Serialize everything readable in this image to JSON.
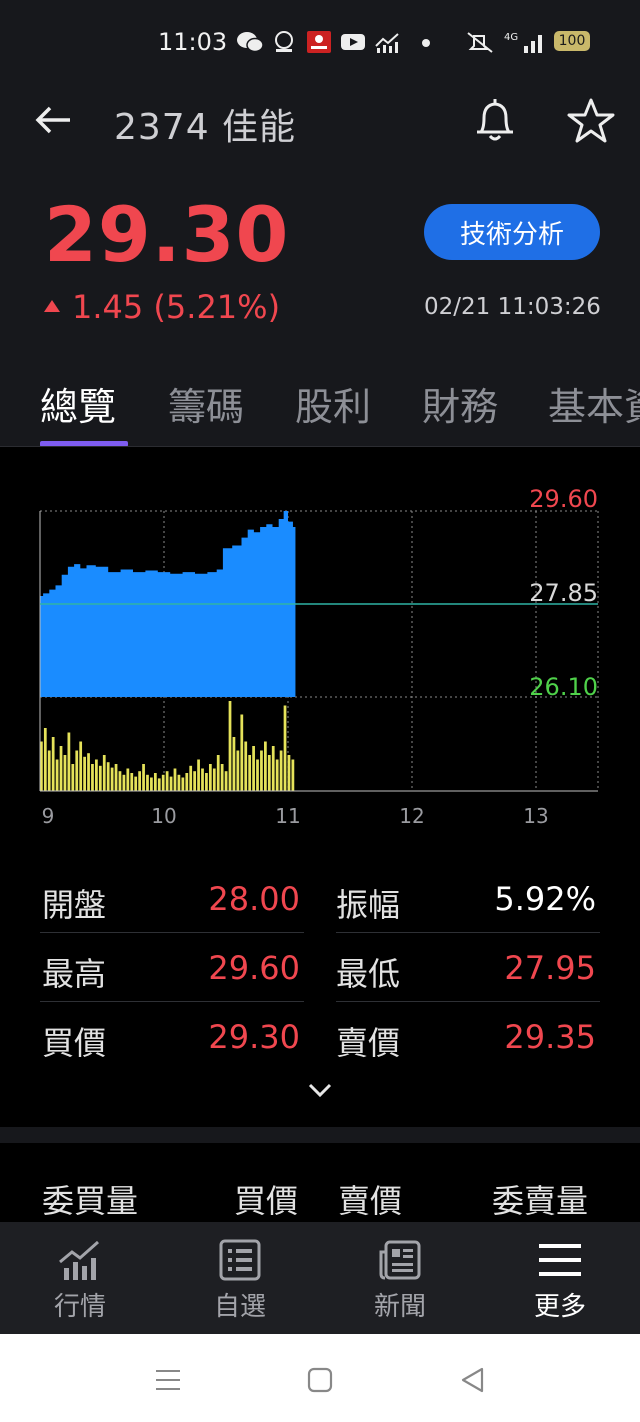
{
  "status_bar": {
    "time": "11:03",
    "battery": "100",
    "network": "4G"
  },
  "header": {
    "title": "2374 佳能",
    "price": "29.30",
    "change": "1.45 (5.21%)",
    "datetime": "02/21 11:03:26",
    "tech_button": "技術分析"
  },
  "tabs": [
    "總覽",
    "籌碼",
    "股利",
    "財務",
    "基本資"
  ],
  "chart_data": {
    "type": "area",
    "title": "",
    "ylim": [
      26.1,
      29.6
    ],
    "y_labels": {
      "high": "29.60",
      "ref": "27.85",
      "low": "26.10"
    },
    "x_ticks": [
      "9",
      "10",
      "11",
      "12",
      "13"
    ],
    "price_series": [
      {
        "t": 9.0,
        "p": 28.0
      },
      {
        "t": 9.05,
        "p": 28.05
      },
      {
        "t": 9.1,
        "p": 28.12
      },
      {
        "t": 9.15,
        "p": 28.2
      },
      {
        "t": 9.2,
        "p": 28.4
      },
      {
        "t": 9.25,
        "p": 28.55
      },
      {
        "t": 9.3,
        "p": 28.6
      },
      {
        "t": 9.35,
        "p": 28.52
      },
      {
        "t": 9.4,
        "p": 28.58
      },
      {
        "t": 9.5,
        "p": 28.55
      },
      {
        "t": 9.6,
        "p": 28.45
      },
      {
        "t": 9.7,
        "p": 28.5
      },
      {
        "t": 9.8,
        "p": 28.45
      },
      {
        "t": 9.9,
        "p": 28.48
      },
      {
        "t": 10.0,
        "p": 28.45
      },
      {
        "t": 10.1,
        "p": 28.42
      },
      {
        "t": 10.2,
        "p": 28.45
      },
      {
        "t": 10.3,
        "p": 28.42
      },
      {
        "t": 10.4,
        "p": 28.45
      },
      {
        "t": 10.45,
        "p": 28.5
      },
      {
        "t": 10.5,
        "p": 28.9
      },
      {
        "t": 10.6,
        "p": 28.95
      },
      {
        "t": 10.65,
        "p": 29.1
      },
      {
        "t": 10.7,
        "p": 29.25
      },
      {
        "t": 10.75,
        "p": 29.2
      },
      {
        "t": 10.8,
        "p": 29.3
      },
      {
        "t": 10.85,
        "p": 29.35
      },
      {
        "t": 10.9,
        "p": 29.3
      },
      {
        "t": 10.95,
        "p": 29.45
      },
      {
        "t": 10.98,
        "p": 29.6
      },
      {
        "t": 11.02,
        "p": 29.4
      },
      {
        "t": 11.06,
        "p": 29.3
      }
    ],
    "volume_series": [
      0.55,
      0.7,
      0.45,
      0.6,
      0.35,
      0.5,
      0.4,
      0.65,
      0.3,
      0.45,
      0.55,
      0.38,
      0.42,
      0.3,
      0.35,
      0.28,
      0.4,
      0.32,
      0.26,
      0.3,
      0.22,
      0.18,
      0.25,
      0.2,
      0.16,
      0.22,
      0.3,
      0.18,
      0.15,
      0.2,
      0.14,
      0.18,
      0.22,
      0.16,
      0.25,
      0.18,
      0.15,
      0.2,
      0.28,
      0.22,
      0.35,
      0.25,
      0.2,
      0.3,
      0.25,
      0.4,
      0.3,
      0.22,
      1.0,
      0.6,
      0.45,
      0.85,
      0.55,
      0.4,
      0.5,
      0.35,
      0.45,
      0.55,
      0.4,
      0.5,
      0.35,
      0.45,
      0.95,
      0.4,
      0.35
    ]
  },
  "stats": {
    "rows": [
      {
        "l_label": "開盤",
        "l_value": "28.00",
        "r_label": "振幅",
        "r_value": "5.92%"
      },
      {
        "l_label": "最高",
        "l_value": "29.60",
        "r_label": "最低",
        "r_value": "27.95"
      },
      {
        "l_label": "買價",
        "l_value": "29.30",
        "r_label": "賣價",
        "r_value": "29.35"
      }
    ]
  },
  "order_book": {
    "h1": "委買量",
    "h2": "買價",
    "h3": "賣價",
    "h4": "委賣量"
  },
  "nav": [
    {
      "label": "行情",
      "icon": "market-chart-icon"
    },
    {
      "label": "自選",
      "icon": "watchlist-icon"
    },
    {
      "label": "新聞",
      "icon": "news-icon"
    },
    {
      "label": "更多",
      "icon": "menu-icon"
    }
  ],
  "colors": {
    "up": "#f0474f",
    "down": "#4fd14a",
    "area": "#1a8cff",
    "volume": "#e5e25a",
    "ref_line": "#2fb3a5",
    "tab_accent": "#7e5cf0",
    "button": "#1f6fe6"
  }
}
